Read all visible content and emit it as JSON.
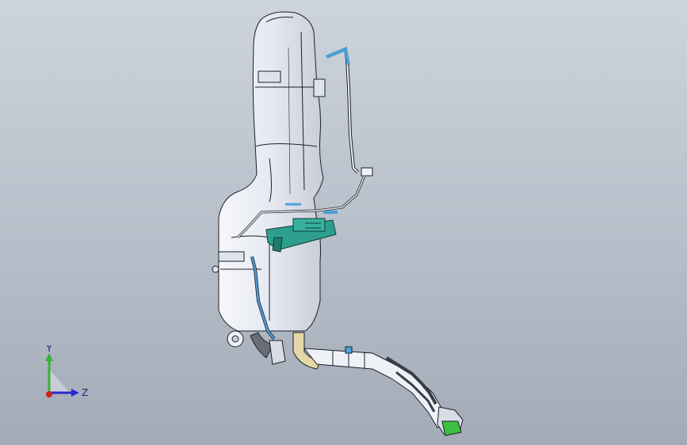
{
  "window": {
    "background": "gradient-gray"
  },
  "model": {
    "description_icon": "fuel-tank-assembly-icon",
    "colors": {
      "tank_shell": "#eef1f6",
      "edges": "#1d1f2a",
      "hose": "#a8c8e8",
      "module": "#2e9e8e",
      "elbow": "#e5d7a6",
      "nozzle": "#3fbf3f"
    }
  },
  "triad": {
    "y_label": "Y",
    "z_label": "Z",
    "colors": {
      "y": "#36b336",
      "z": "#2a2ad0",
      "x": "#d02020"
    }
  }
}
